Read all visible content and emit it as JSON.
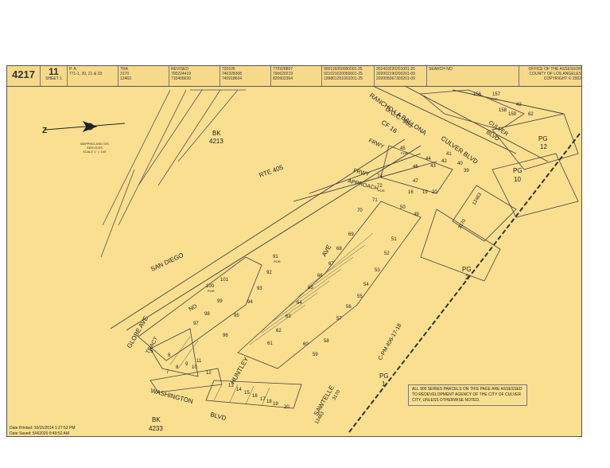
{
  "header": {
    "map_book": "4217",
    "page": "11",
    "sheet": "SHEET 1",
    "pa_lines": [
      "P. A.",
      "771-1, 20, 21 & 23"
    ],
    "tra_lines": [
      "TRA",
      "3170",
      "12463"
    ],
    "revised_lines": [
      "REVISED",
      "700224419",
      "710406620"
    ],
    "col4_lines": [
      "720105",
      "740328308",
      "740918604"
    ],
    "col5_lines": [
      "770928807",
      "790620219",
      "820602364"
    ],
    "col6_lines": [
      "900116050080001-25",
      "921021020050001-25",
      "199801251001001-25"
    ],
    "col7_lines": [
      "201410220201001-25",
      "202002190200201-09",
      "202005067300201-09"
    ],
    "search_no": "SEARCH NO",
    "office_lines": [
      "OFFICE OF THE ASSESSOR",
      "COUNTY OF LOS ANGELES",
      "COPYRIGHT © 2002"
    ]
  },
  "legend": {
    "mapping_lines": [
      "MAPPING AND GIS",
      "SERVICES",
      "SCALE 1\" = 100'"
    ]
  },
  "streets": {
    "rancho": "RANCHO LA BALLONA",
    "dcc": "D.C.C. 965",
    "cf": "CF 16",
    "culver_blvd": "CULVER BLVD",
    "culver_top": "CULVER",
    "blvd_top": "BLVD",
    "frwy_top": "FRWY",
    "frwy_approach": "FRWY",
    "approach": "APPROACH",
    "rte": "RTE 405",
    "san_diego": "SAN DIEGO",
    "globe_ave": "GLOBE AVE",
    "washington": "WASHINGTON",
    "blvd_bottom": "BLVD",
    "huntley": "HUNTLEY",
    "sawtelle": "SAWTELLE",
    "ave": "AVE",
    "tract": "TRACT",
    "no": "NO",
    "cpm": "C-PM 406-17-18"
  },
  "book_refs": {
    "bk_top": [
      "BK",
      "4213"
    ],
    "bk_bottom": [
      "BK",
      "4233"
    ],
    "pg12": [
      "PG",
      "12"
    ],
    "pg10": [
      "PG",
      "10"
    ],
    "pg2": [
      "PG",
      "2"
    ],
    "pg1": [
      "PG",
      "1"
    ]
  },
  "tra_codes": [
    "12463",
    "3170",
    "12463",
    "3170"
  ],
  "parcels": {
    "block_top": [
      "156",
      "157",
      "158",
      "159",
      "42",
      "62"
    ],
    "block_culver": [
      "45",
      "44",
      "43",
      "42",
      "41",
      "40",
      "39",
      "46",
      "47",
      "74",
      "16",
      "19",
      "20"
    ],
    "block_approach": [
      "72",
      "71",
      "70",
      "50",
      "49",
      "51",
      "52",
      "69",
      "68",
      "67",
      "53",
      "54",
      "66",
      "65",
      "56",
      "57",
      "64",
      "63",
      "62",
      "61",
      "60",
      "59",
      "58",
      "55"
    ],
    "block_wedge": [
      "91",
      "92",
      "93",
      "94",
      "95",
      "101",
      "100",
      "96",
      "97",
      "98",
      "99"
    ],
    "block_sw": [
      "5",
      "6",
      "7",
      "8",
      "9",
      "10",
      "11",
      "12"
    ],
    "block_s": [
      "13",
      "14",
      "15",
      "16",
      "17",
      "18",
      "19",
      "20"
    ],
    "por_labels": [
      "POR",
      "POR",
      "POR",
      "POR",
      "POR"
    ]
  },
  "notice": "ALL 900 SERIES PARCELS ON THIS PAGE ARE ASSESSED TO REDEVELOPMENT AGENCY OF THE CITY OF CULVER CITY, UNLESS OTHERWISE NOTED.",
  "footer": {
    "printed": "Date Printed: 10/15/2014 1:27:52 PM",
    "saved": "Date Saved: 5/4/2020 9:49:52 AM"
  }
}
